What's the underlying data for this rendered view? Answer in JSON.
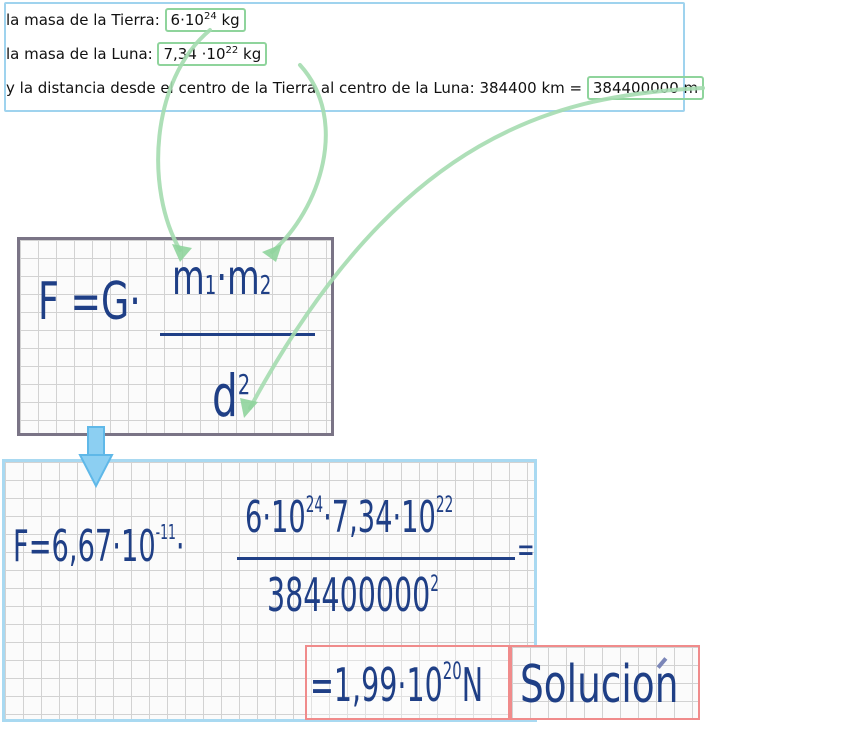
{
  "data_lines": {
    "earth": {
      "prefix": "la masa de la Tierra: ",
      "mantissa": "6·10",
      "exp": "24",
      "unit": " kg"
    },
    "moon": {
      "prefix": "la masa de la Luna: ",
      "mantissa": "7,34 ·10",
      "exp": "22",
      "unit": " kg"
    },
    "distance": {
      "prefix": "y la distancia desde el centro de la Tierra al centro de la Luna: 384400 km = ",
      "value": "384400000 m"
    }
  },
  "formula": {
    "lhs": "F =G·",
    "m1": "m",
    "sub1": "1",
    "dot": "·",
    "m2": "m",
    "sub2": "2",
    "den": "d",
    "den_exp": "2"
  },
  "calc": {
    "lhs": "F=6,67·10",
    "lhs_exp": "-11",
    "dot": "·",
    "num_a": "6·10",
    "num_a_exp": "24",
    "num_b": "·7,34·10",
    "num_b_exp": "22",
    "den": "384400000",
    "den_exp": "2",
    "eq": "="
  },
  "result": {
    "text": "=1,99·10",
    "exp": "20",
    "unit": "N"
  },
  "solution_label": "Solucion",
  "colors": {
    "arrow_green": "#8fd49c",
    "arrow_blue": "#5fb8e8",
    "ink": "#1f3f86",
    "box_blue": "#9fd3ee",
    "box_red": "#f08b8b",
    "box_grey": "#7a7486"
  }
}
